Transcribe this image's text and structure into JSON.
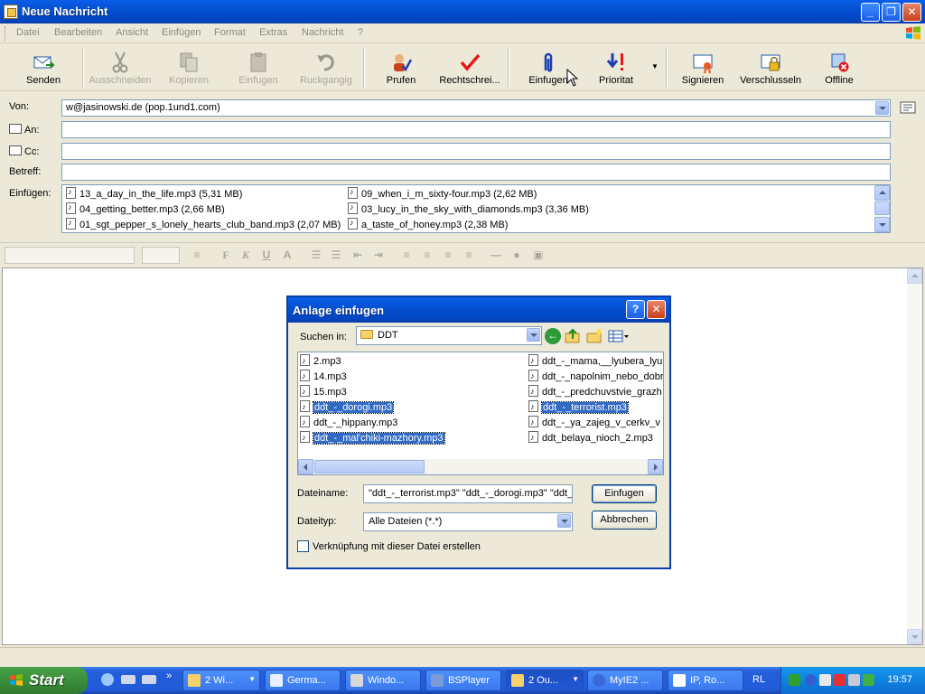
{
  "window": {
    "title": "Neue Nachricht"
  },
  "menu": [
    "Datei",
    "Bearbeiten",
    "Ansicht",
    "Einfügen",
    "Format",
    "Extras",
    "Nachricht",
    "?"
  ],
  "toolbar": [
    {
      "label": "Senden",
      "icon": "send-icon"
    },
    {
      "label": "Ausschneiden",
      "icon": "scissors-icon"
    },
    {
      "label": "Kopieren",
      "icon": "copy-icon"
    },
    {
      "label": "Einfugen",
      "icon": "paste-icon"
    },
    {
      "label": "Ruckgangig",
      "icon": "undo-icon"
    },
    {
      "label": "Prufen",
      "icon": "check-names-icon"
    },
    {
      "label": "Rechtschrei...",
      "icon": "spellcheck-icon"
    },
    {
      "label": "Einfugen",
      "icon": "paperclip-icon"
    },
    {
      "label": "Prioritat",
      "icon": "priority-icon"
    },
    {
      "label": "Signieren",
      "icon": "sign-icon"
    },
    {
      "label": "Verschlusseln",
      "icon": "encrypt-icon"
    },
    {
      "label": "Offline",
      "icon": "offline-icon"
    }
  ],
  "header": {
    "from_label": "Von:",
    "from_value": "w@jasinowski.de     (pop.1und1.com)",
    "to_label": "An:",
    "cc_label": "Cc:",
    "subject_label": "Betreff:",
    "attach_label": "Einfügen:",
    "attachments": [
      "13_a_day_in_the_life.mp3 (5,31 MB)",
      "09_when_i_m_sixty-four.mp3 (2,62 MB)",
      "04_getting_better.mp3 (2,66 MB)",
      "03_lucy_in_the_sky_with_diamonds.mp3 (3,36 MB)",
      "01_sgt_pepper_s_lonely_hearts_club_band.mp3 (2,07 MB)",
      "a_taste_of_honey.mp3 (2,38 MB)"
    ]
  },
  "dialog": {
    "title": "Anlage einfugen",
    "lookin_label": "Suchen in:",
    "lookin_value": "DDT",
    "files": [
      {
        "name": "2.mp3",
        "selected": false
      },
      {
        "name": "14.mp3",
        "selected": false
      },
      {
        "name": "15.mp3",
        "selected": false
      },
      {
        "name": "ddt_-_dorogi.mp3",
        "selected": true
      },
      {
        "name": "ddt_-_hippany.mp3",
        "selected": false
      },
      {
        "name": "ddt_-_mal'chiki-mazhory.mp3",
        "selected": true
      },
      {
        "name": "ddt_-_mama,__lyubera_lyul",
        "selected": false
      },
      {
        "name": "ddt_-_napolnim_nebo_dobr",
        "selected": false
      },
      {
        "name": "ddt_-_predchuvstvie_grazh",
        "selected": false
      },
      {
        "name": "ddt_-_terrorist.mp3",
        "selected": true
      },
      {
        "name": "ddt_-_ya_zajeg_v_cerkv_v",
        "selected": false
      },
      {
        "name": "ddt_belaya_nioch_2.mp3",
        "selected": false
      }
    ],
    "filename_label": "Dateiname:",
    "filename_value": "\"ddt_-_terrorist.mp3\" \"ddt_-_dorogi.mp3\" \"ddt_-",
    "filetype_label": "Dateityp:",
    "filetype_value": "Alle Dateien (*.*)",
    "insert_button": "Einfugen",
    "cancel_button": "Abbrechen",
    "link_checkbox": "Verknüpfung mit dieser Datei erstellen"
  },
  "taskbar": {
    "start": "Start",
    "items": [
      "2 Wi...",
      "Germa...",
      "Windo...",
      "BSPlayer",
      "2 Ou...",
      "MyIE2 ...",
      "IP, Ro..."
    ],
    "lang": "RL",
    "clock": "19:57"
  },
  "colors": {
    "titlebar": "#0451d2",
    "selection": "#316ac5",
    "start": "#3b8f3b"
  }
}
